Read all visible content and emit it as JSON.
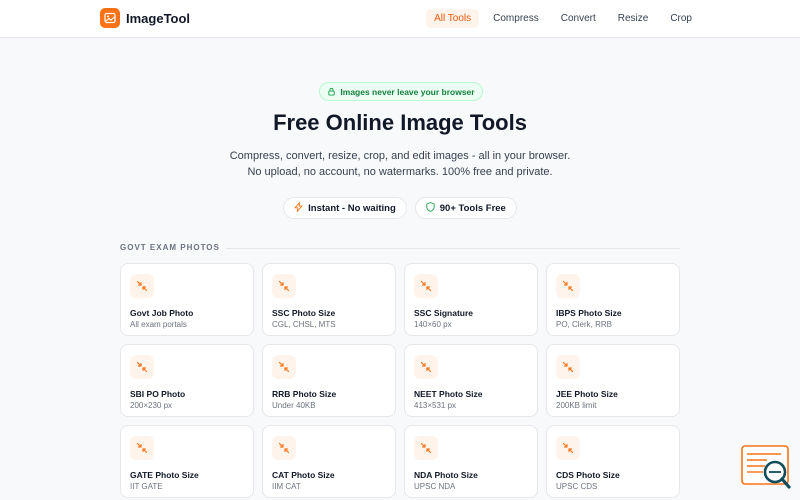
{
  "brand": {
    "name": "ImageTool",
    "accent": "#f97316"
  },
  "nav": {
    "items": [
      {
        "label": "All Tools",
        "active": true
      },
      {
        "label": "Compress",
        "active": false
      },
      {
        "label": "Convert",
        "active": false
      },
      {
        "label": "Resize",
        "active": false
      },
      {
        "label": "Crop",
        "active": false
      }
    ]
  },
  "hero": {
    "badge": "Images never leave your browser",
    "badge_icon": "lock-icon",
    "title": "Free Online Image Tools",
    "subtitle_line1": "Compress, convert, resize, crop, and edit images - all in your browser.",
    "subtitle_line2": "No upload, no account, no watermarks. 100% free and private.",
    "pills": [
      {
        "label": "Instant - No waiting",
        "icon": "lightning-icon"
      },
      {
        "label": "90+ Tools Free",
        "icon": "shield-icon"
      }
    ]
  },
  "section": {
    "label": "GOVT EXAM PHOTOS",
    "cards": [
      {
        "title": "Govt Job Photo",
        "subtitle": "All exam portals",
        "icon": "compress-arrows-icon"
      },
      {
        "title": "SSC Photo Size",
        "subtitle": "CGL, CHSL, MTS",
        "icon": "compress-arrows-icon"
      },
      {
        "title": "SSC Signature",
        "subtitle": "140×60 px",
        "icon": "compress-arrows-icon"
      },
      {
        "title": "IBPS Photo Size",
        "subtitle": "PO, Clerk, RRB",
        "icon": "compress-arrows-icon"
      },
      {
        "title": "SBI PO Photo",
        "subtitle": "200×230 px",
        "icon": "compress-arrows-icon"
      },
      {
        "title": "RRB Photo Size",
        "subtitle": "Under 40KB",
        "icon": "compress-arrows-icon"
      },
      {
        "title": "NEET Photo Size",
        "subtitle": "413×531 px",
        "icon": "compress-arrows-icon"
      },
      {
        "title": "JEE Photo Size",
        "subtitle": "200KB limit",
        "icon": "compress-arrows-icon"
      },
      {
        "title": "GATE Photo Size",
        "subtitle": "IIT GATE",
        "icon": "compress-arrows-icon"
      },
      {
        "title": "CAT Photo Size",
        "subtitle": "IIM CAT",
        "icon": "compress-arrows-icon"
      },
      {
        "title": "NDA Photo Size",
        "subtitle": "UPSC NDA",
        "icon": "compress-arrows-icon"
      },
      {
        "title": "CDS Photo Size",
        "subtitle": "UPSC CDS",
        "icon": "compress-arrows-icon"
      }
    ]
  },
  "floating": {
    "icon": "search-document-icon"
  }
}
